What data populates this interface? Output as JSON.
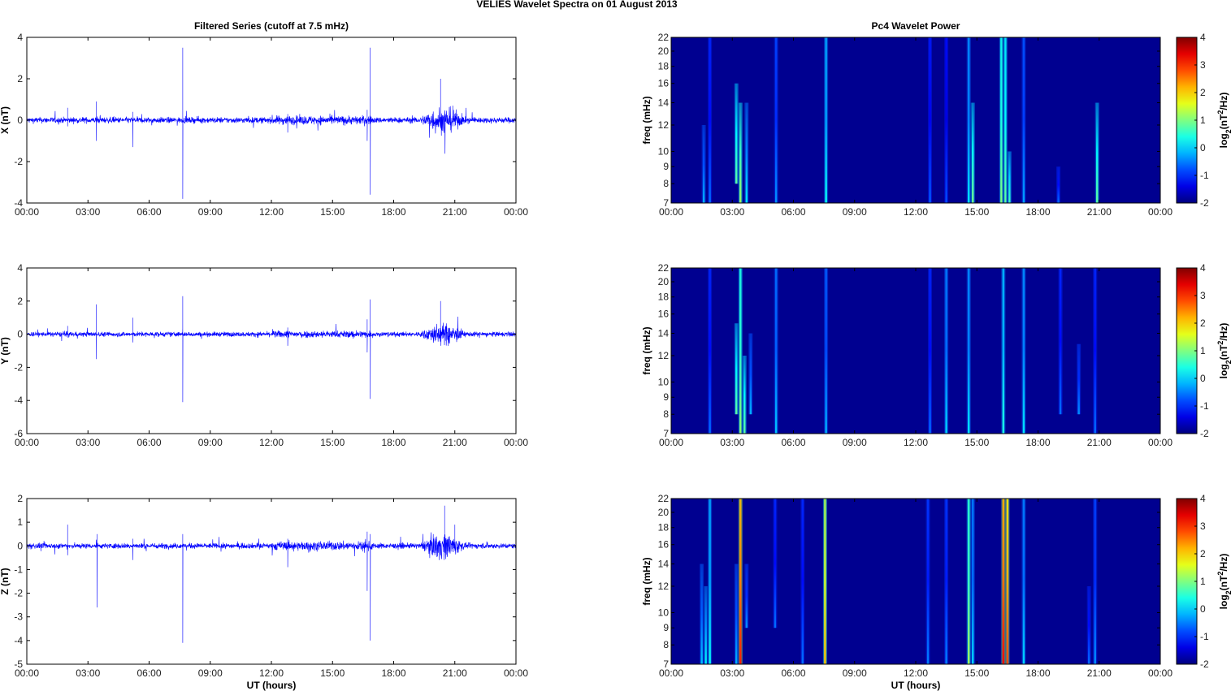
{
  "figure": {
    "suptitle": "VELIES Wavelet Spectra on 01 August    2013",
    "left_title": "Filtered Series (cutoff at 7.5 mHz)",
    "right_title": "Pc4 Wavelet Power",
    "xlabel": "UT (hours)",
    "time_ticks": [
      "00:00",
      "03:00",
      "06:00",
      "09:00",
      "12:00",
      "15:00",
      "18:00",
      "21:00",
      "00:00"
    ],
    "colors": {
      "line": "#0000ff",
      "axis": "#000000"
    }
  },
  "chart_data": [
    {
      "type": "line",
      "name": "x-series",
      "ylabel": "X (nT)",
      "ylim": [
        -4,
        4
      ],
      "yticks": [
        -4,
        -2,
        0,
        2,
        4
      ],
      "xlim": [
        0,
        24
      ],
      "noise": 0.1,
      "active_band": [
        19.3,
        21.5,
        0.35
      ],
      "spikes": [
        [
          2.0,
          0.6,
          -0.3
        ],
        [
          3.4,
          0.9,
          -1.0
        ],
        [
          5.2,
          0.4,
          -1.3
        ],
        [
          7.65,
          3.5,
          -3.8
        ],
        [
          12.8,
          0.3,
          -0.6
        ],
        [
          16.85,
          3.5,
          -3.6
        ],
        [
          16.7,
          0.5,
          -1.0
        ],
        [
          20.3,
          2.0,
          -0.4
        ],
        [
          20.9,
          0.7,
          -0.3
        ]
      ]
    },
    {
      "type": "line",
      "name": "y-series",
      "ylabel": "Y (nT)",
      "ylim": [
        -6,
        4
      ],
      "yticks": [
        -6,
        -4,
        -2,
        0,
        2,
        4
      ],
      "xlim": [
        0,
        24
      ],
      "noise": 0.1,
      "active_band": [
        19.3,
        21.5,
        0.35
      ],
      "spikes": [
        [
          2.0,
          0.5,
          -0.2
        ],
        [
          3.4,
          1.8,
          -1.5
        ],
        [
          5.2,
          1.0,
          -0.5
        ],
        [
          7.65,
          2.3,
          -4.1
        ],
        [
          12.8,
          0.4,
          -0.7
        ],
        [
          16.85,
          2.1,
          -3.9
        ],
        [
          16.7,
          0.9,
          -1.1
        ],
        [
          20.3,
          2.0,
          -0.3
        ]
      ]
    },
    {
      "type": "line",
      "name": "z-series",
      "ylabel": "Z (nT)",
      "ylim": [
        -5,
        2
      ],
      "yticks": [
        -5,
        -4,
        -3,
        -2,
        -1,
        0,
        1,
        2
      ],
      "xlim": [
        0,
        24
      ],
      "noise": 0.08,
      "active_band": [
        19.3,
        21.5,
        0.3
      ],
      "spikes": [
        [
          2.0,
          0.9,
          -0.4
        ],
        [
          3.45,
          0.5,
          -2.6
        ],
        [
          5.2,
          0.3,
          -0.6
        ],
        [
          7.65,
          0.5,
          -4.1
        ],
        [
          12.8,
          0.3,
          -0.9
        ],
        [
          16.7,
          0.6,
          -1.9
        ],
        [
          16.85,
          0.5,
          -4.0
        ],
        [
          20.5,
          1.7,
          -0.3
        ],
        [
          21.0,
          0.9,
          -0.2
        ]
      ]
    },
    {
      "type": "heatmap",
      "name": "x-wavelet",
      "ylabel": "freq (mHz)",
      "ylim": [
        7,
        22
      ],
      "yscale": "log",
      "yticks": [
        7,
        8,
        9,
        10,
        12,
        14,
        16,
        18,
        20,
        22
      ],
      "clim": [
        -2,
        4
      ],
      "cbar_ticks": [
        -2,
        -1,
        0,
        1,
        2,
        3,
        4
      ],
      "cbar_label": "log2(nT2/Hz)",
      "streaks": [
        [
          1.6,
          7,
          12,
          -0.8
        ],
        [
          1.9,
          7,
          22,
          -1.2
        ],
        [
          3.2,
          8,
          16,
          0.2
        ],
        [
          3.4,
          7,
          14,
          0.6
        ],
        [
          3.7,
          7,
          14,
          -0.5
        ],
        [
          5.15,
          7,
          22,
          -1.0
        ],
        [
          7.6,
          7,
          22,
          -0.3
        ],
        [
          12.7,
          7,
          22,
          -1.3
        ],
        [
          13.5,
          7,
          22,
          -1.4
        ],
        [
          14.6,
          7,
          22,
          -0.5
        ],
        [
          14.8,
          7,
          14,
          0.3
        ],
        [
          16.2,
          7,
          22,
          0.4
        ],
        [
          16.4,
          7,
          22,
          0.2
        ],
        [
          16.6,
          7,
          10,
          0.0
        ],
        [
          17.3,
          7,
          22,
          -0.9
        ],
        [
          19.0,
          7,
          9,
          -1.2
        ],
        [
          20.9,
          7,
          14,
          0.2
        ]
      ]
    },
    {
      "type": "heatmap",
      "name": "y-wavelet",
      "ylabel": "freq (mHz)",
      "ylim": [
        7,
        22
      ],
      "yscale": "log",
      "yticks": [
        7,
        8,
        9,
        10,
        12,
        14,
        16,
        18,
        20,
        22
      ],
      "clim": [
        -2,
        4
      ],
      "cbar_ticks": [
        -2,
        -1,
        0,
        1,
        2,
        3,
        4
      ],
      "cbar_label": "log2(nT2/Hz)",
      "streaks": [
        [
          1.9,
          7,
          22,
          -1.2
        ],
        [
          3.2,
          8,
          15,
          0.2
        ],
        [
          3.4,
          7,
          22,
          0.5
        ],
        [
          3.6,
          7,
          12,
          0.2
        ],
        [
          3.9,
          8,
          14,
          -0.8
        ],
        [
          5.15,
          7,
          22,
          -0.7
        ],
        [
          7.6,
          7,
          22,
          -0.8
        ],
        [
          12.7,
          7,
          22,
          -1.2
        ],
        [
          13.5,
          7,
          22,
          -0.6
        ],
        [
          14.6,
          7,
          22,
          -0.5
        ],
        [
          16.3,
          7,
          22,
          -0.2
        ],
        [
          17.3,
          7,
          22,
          -0.5
        ],
        [
          19.1,
          8,
          22,
          -1.2
        ],
        [
          20.0,
          8,
          13,
          -1.0
        ],
        [
          20.8,
          7,
          22,
          -1.2
        ]
      ]
    },
    {
      "type": "heatmap",
      "name": "z-wavelet",
      "ylabel": "freq (mHz)",
      "ylim": [
        7,
        22
      ],
      "yscale": "log",
      "yticks": [
        7,
        8,
        9,
        10,
        12,
        14,
        16,
        18,
        20,
        22
      ],
      "clim": [
        -2,
        4
      ],
      "cbar_ticks": [
        -2,
        -1,
        0,
        1,
        2,
        3,
        4
      ],
      "cbar_label": "log2(nT2/Hz)",
      "streaks": [
        [
          1.5,
          7,
          14,
          -0.7
        ],
        [
          1.7,
          7,
          12,
          -0.4
        ],
        [
          1.9,
          7,
          22,
          -0.3
        ],
        [
          3.2,
          7,
          14,
          -0.8
        ],
        [
          3.4,
          7,
          22,
          2.5
        ],
        [
          3.7,
          9,
          14,
          -1.0
        ],
        [
          5.1,
          9,
          22,
          -1.2
        ],
        [
          6.45,
          7,
          22,
          -1.2
        ],
        [
          7.55,
          7,
          22,
          1.5
        ],
        [
          12.6,
          7,
          22,
          -1.1
        ],
        [
          13.5,
          7,
          22,
          -1.1
        ],
        [
          14.6,
          7,
          22,
          0.6
        ],
        [
          14.8,
          7,
          22,
          -0.6
        ],
        [
          16.3,
          7,
          22,
          2.6
        ],
        [
          16.5,
          7,
          22,
          2.2
        ],
        [
          17.3,
          7,
          22,
          -0.6
        ],
        [
          20.5,
          7,
          12,
          -1.2
        ],
        [
          20.8,
          7,
          22,
          -1.0
        ]
      ]
    }
  ]
}
